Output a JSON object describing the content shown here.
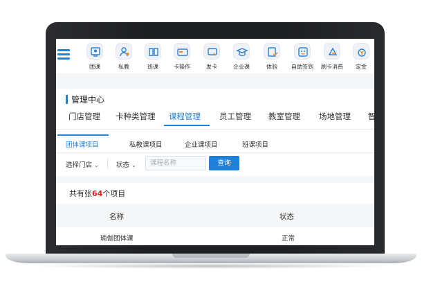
{
  "nav": {
    "items": [
      {
        "label": "团课",
        "icon": "group-class-icon"
      },
      {
        "label": "私教",
        "icon": "private-coach-icon"
      },
      {
        "label": "班课",
        "icon": "class-icon"
      },
      {
        "label": "卡操作",
        "icon": "card-operation-icon"
      },
      {
        "label": "发卡",
        "icon": "issue-card-icon"
      },
      {
        "label": "企业课",
        "icon": "enterprise-class-icon"
      },
      {
        "label": "体验",
        "icon": "trial-icon"
      },
      {
        "label": "自助签到",
        "icon": "self-checkin-icon"
      },
      {
        "label": "刷卡消费",
        "icon": "card-swipe-icon"
      },
      {
        "label": "定金",
        "icon": "deposit-icon"
      }
    ]
  },
  "page": {
    "title": "管理中心"
  },
  "module_tabs": [
    "门店管理",
    "卡种类管理",
    "课程管理",
    "员工管理",
    "教室管理",
    "场地管理",
    "智"
  ],
  "active_module": "课程管理",
  "sub_tabs": [
    "团体课项目",
    "私教课项目",
    "企业课项目",
    "班课项目"
  ],
  "active_sub_tab": "团体课项目",
  "filters": {
    "store_label": "选择门店",
    "status_label": "状态",
    "search_placeholder": "课程名称",
    "query_button": "查询"
  },
  "summary": {
    "prefix": "共有张",
    "count": "64",
    "suffix": "个项目"
  },
  "table": {
    "columns": [
      "名称",
      "状态"
    ],
    "rows": [
      {
        "name": "瑜伽团体课",
        "status": "正常"
      }
    ]
  },
  "colors": {
    "accent": "#1f82d8",
    "count_red": "#e02020",
    "bezel": "#1e1f22"
  }
}
